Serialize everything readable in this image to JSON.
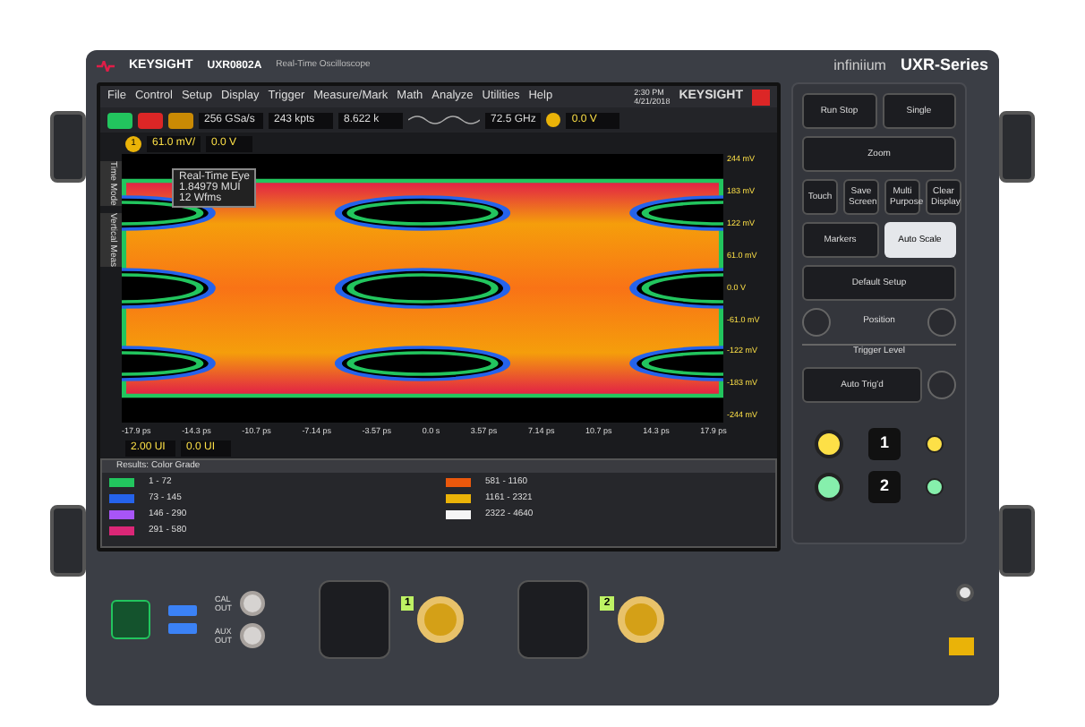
{
  "header": {
    "brand": "KEYSIGHT",
    "model": "UXR0802A",
    "description": "Real-Time Oscilloscope",
    "product_line": "infiniium",
    "series": "UXR-Series"
  },
  "menu": [
    "File",
    "Control",
    "Setup",
    "Display",
    "Trigger",
    "Measure/Mark",
    "Math",
    "Analyze",
    "Utilities",
    "Help"
  ],
  "clock": {
    "time": "2:30 PM",
    "date": "4/21/2018"
  },
  "screen_brand": "KEYSIGHT",
  "acquisition_buttons": [
    {
      "color": "#22c55e"
    },
    {
      "color": "#dc2626"
    },
    {
      "color": "#ca8a04"
    }
  ],
  "toolbar": {
    "sample_rate": "256 GSa/s",
    "memory_depth": "243 kpts",
    "acquisitions": "8.622 k",
    "bandwidth": "72.5 GHz",
    "trigger_level": "0.0 V"
  },
  "channel": {
    "number": "1",
    "scale": "61.0 mV/",
    "offset": "0.0 V"
  },
  "side_tabs": [
    "Time Mode",
    "Vertical Meas"
  ],
  "eye_label": [
    "Real-Time Eye",
    "1.84979 MUI",
    "12 Wfms"
  ],
  "y_ticks": [
    "244 mV",
    "183 mV",
    "122 mV",
    "61.0 mV",
    "0.0 V",
    "-61.0 mV",
    "-122 mV",
    "-183 mV",
    "-244 mV"
  ],
  "x_ticks": [
    "-17.9 ps",
    "-14.3 ps",
    "-10.7 ps",
    "-7.14 ps",
    "-3.57 ps",
    "0.0 s",
    "3.57 ps",
    "7.14 ps",
    "10.7 ps",
    "14.3 ps",
    "17.9 ps"
  ],
  "timebase": {
    "scale": "2.00 UI",
    "offset": "0.0 UI"
  },
  "results": {
    "title": "Results: Color Grade",
    "items": [
      {
        "range": "1 - 72",
        "color": "#22c55e"
      },
      {
        "range": "73 - 145",
        "color": "#2563eb"
      },
      {
        "range": "146 - 290",
        "color": "#a855f7"
      },
      {
        "range": "291 - 580",
        "color": "#db2777"
      },
      {
        "range": "581 - 1160",
        "color": "#ea580c"
      },
      {
        "range": "1161 - 2321",
        "color": "#eab308"
      },
      {
        "range": "2322 - 4640",
        "color": "#f5f5f5"
      }
    ]
  },
  "front_panel": {
    "rows": [
      [
        "Run Stop",
        "Single"
      ],
      [
        "Zoom"
      ],
      [
        "Touch",
        "Save Screen",
        "Multi Purpose",
        "Clear Display"
      ],
      [
        "Markers",
        "Auto Scale"
      ],
      [
        "Default Setup"
      ]
    ],
    "position_label": "Position",
    "trigger_label": "Trigger Level",
    "trigger_buttons": [
      "Auto Trig'd"
    ],
    "channels": [
      {
        "label": "1",
        "color": "#fde047"
      },
      {
        "label": "2",
        "color": "#86efac"
      }
    ]
  },
  "ports": {
    "cal_out": "CAL OUT",
    "aux_out": "AUX OUT",
    "inputs": [
      "1",
      "2"
    ]
  }
}
